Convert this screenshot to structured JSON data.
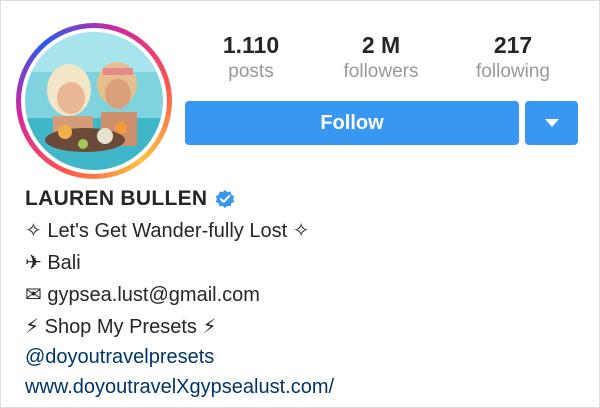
{
  "profile": {
    "stats": {
      "posts_count": "1.110",
      "posts_label": "posts",
      "followers_count": "2 M",
      "followers_label": "followers",
      "following_count": "217",
      "following_label": "following"
    },
    "follow_label": "Follow",
    "name": "LAUREN BULLEN",
    "verified": true,
    "bio": {
      "tagline": "✧ Let's Get Wander-fully Lost ✧",
      "location": "✈ Bali",
      "email": "✉ gypsea.lust@gmail.com",
      "shop": "⚡ Shop My Presets ⚡",
      "mention": "@doyoutravelpresets",
      "website": "www.doyoutravelXgypsealust.com/"
    }
  },
  "colors": {
    "button_blue": "#3897f0",
    "link_blue": "#003569",
    "muted_gray": "#999999",
    "verified_blue": "#3897f0"
  },
  "icons": {
    "dropdown": "chevron-down-icon",
    "verified": "verified-badge-icon"
  }
}
